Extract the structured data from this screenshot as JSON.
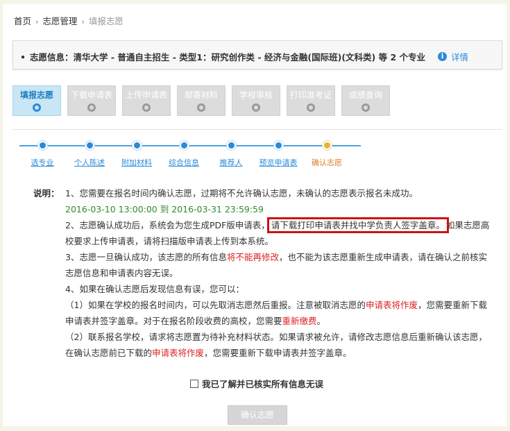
{
  "breadcrumb": {
    "home": "首页",
    "section": "志愿管理",
    "current": "填报志愿"
  },
  "info": {
    "label": "志愿信息：",
    "content": "清华大学 - 普通自主招生 - 类型1：研究创作类 - 经济与金融(国际班)(文科类) 等 2 个专业",
    "detail_label": "详情"
  },
  "tabs": [
    {
      "label": "填报志愿",
      "active": true
    },
    {
      "label": "下载申请表",
      "active": false
    },
    {
      "label": "上传申请表",
      "active": false
    },
    {
      "label": "邮寄材料",
      "active": false
    },
    {
      "label": "学校审核",
      "active": false
    },
    {
      "label": "打印准考证",
      "active": false
    },
    {
      "label": "成绩查询",
      "active": false
    }
  ],
  "steps": [
    {
      "label": "选专业",
      "current": false
    },
    {
      "label": "个人陈述",
      "current": false
    },
    {
      "label": "附加材料",
      "current": false
    },
    {
      "label": "综合信息",
      "current": false
    },
    {
      "label": "推荐人",
      "current": false
    },
    {
      "label": "预览申请表",
      "current": false
    },
    {
      "label": "确认志愿",
      "current": true
    }
  ],
  "explanation": {
    "title": "说明：",
    "p1": "1、您需要在报名时间内确认志愿，过期将不允许确认志愿，未确认的志愿表示报名未成功。",
    "p1_time": "2016-03-10 13:00:00 到 2016-03-31 23:59:59",
    "p2_a": "2、志愿确认成功后，系统会为您生成PDF版申请表，",
    "p2_highlight": "请下载打印申请表并找中学负责人签字盖章。",
    "p2_b": "如果志愿高",
    "p2_c": "校要求上传申请表，请将扫描版申请表上传到本系统。",
    "p3_a": "3、志愿一旦确认成功，该志愿的所有信息",
    "p3_red": "将不能再修改",
    "p3_b": "，也不能为该志愿重新生成申请表，请在确认之前核实",
    "p3_c": "志愿信息和申请表内容无误。",
    "p4": "4、如果在确认志愿后发现信息有误，您可以：",
    "p4_1a": "（1）如果在学校的报名时间内，可以先取消志愿然后重报。注意被取消志愿的",
    "p4_1red": "申请表将作废",
    "p4_1b": "，您需要重新下载",
    "p4_1c": "申请表并签字盖章。对于在报名阶段收费的高校，您需要",
    "p4_1red2": "重新缴费",
    "p4_1d": "。",
    "p4_2a": "（2）联系报名学校，请求将志愿置为待补充材料状态。如果请求被允许，请修改志愿信息后重新确认该志愿，",
    "p4_2b": "在确认志愿前已下载的",
    "p4_2red": "申请表将作废",
    "p4_2c": "，您需要重新下载申请表并签字盖章。"
  },
  "confirm": {
    "checkbox_label": "我已了解并已核实所有信息无误",
    "button_label": "确认志愿"
  }
}
